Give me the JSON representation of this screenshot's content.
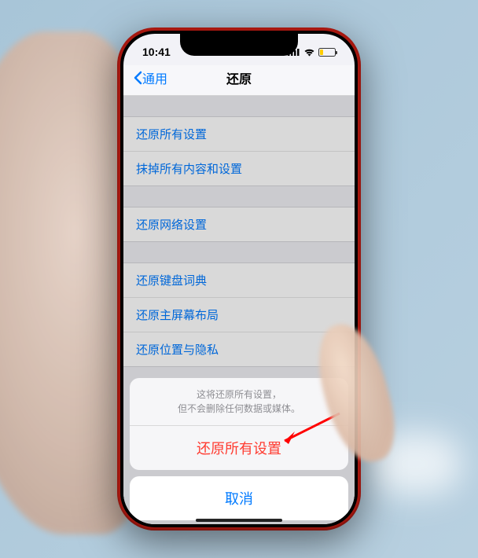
{
  "status": {
    "time": "10:41"
  },
  "nav": {
    "back_label": "通用",
    "title": "还原"
  },
  "groups": [
    {
      "items": [
        {
          "label": "还原所有设置"
        },
        {
          "label": "抹掉所有内容和设置"
        }
      ]
    },
    {
      "items": [
        {
          "label": "还原网络设置"
        }
      ]
    },
    {
      "items": [
        {
          "label": "还原键盘词典"
        },
        {
          "label": "还原主屏幕布局"
        },
        {
          "label": "还原位置与隐私"
        }
      ]
    }
  ],
  "sheet": {
    "message_line1": "这将还原所有设置，",
    "message_line2": "但不会删除任何数据或媒体。",
    "destructive_label": "还原所有设置",
    "cancel_label": "取消"
  }
}
